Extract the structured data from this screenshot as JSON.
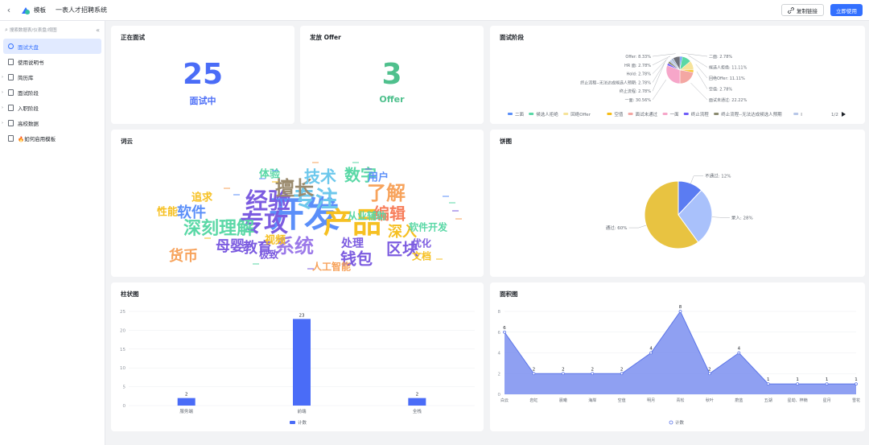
{
  "topbar": {
    "back_icon": "chevron-left-icon",
    "template_label": "模板",
    "app_title": "一表人才招聘系统",
    "copy_link": "复制链接",
    "use_now": "立即使用"
  },
  "sidebar": {
    "search_placeholder": "搜索数据表/仪表盘/视图",
    "items": [
      {
        "label": "面试大盘",
        "active": true,
        "expandable": false
      },
      {
        "label": "使用说明书",
        "active": false,
        "expandable": false
      },
      {
        "label": "简历库",
        "active": false,
        "expandable": true
      },
      {
        "label": "面试阶段",
        "active": false,
        "expandable": true
      },
      {
        "label": "入职阶段",
        "active": false,
        "expandable": true
      },
      {
        "label": "高校数据",
        "active": false,
        "expandable": true
      },
      {
        "label": "🔥如何启用模板",
        "active": false,
        "expandable": false
      }
    ]
  },
  "cards": {
    "interviewing": {
      "title": "正在面试",
      "value": "25",
      "label": "面试中",
      "color": "#4a6cf7"
    },
    "offer": {
      "title": "发放 Offer",
      "value": "3",
      "label": "Offer",
      "color": "#4fc08d"
    },
    "stage": {
      "title": "面试阶段"
    },
    "wordcloud": {
      "title": "词云"
    },
    "pie": {
      "title": "饼图"
    },
    "bar": {
      "title": "柱状图"
    },
    "area": {
      "title": "面积图"
    }
  },
  "chart_data": [
    {
      "type": "pie",
      "title": "面试阶段",
      "slices": [
        {
          "name": "二面",
          "value": 2.78,
          "label": "二面: 2.78%",
          "color": "#5b8ff9"
        },
        {
          "name": "候选人拒绝",
          "value": 11.11,
          "label": "候选人拒绝: 11.11%",
          "color": "#5ad8a6"
        },
        {
          "name": "回绝Offer",
          "value": 11.11,
          "label": "回绝Offer: 11.11%",
          "color": "#f6e39a"
        },
        {
          "name": "空值",
          "value": 2.78,
          "label": "空值: 2.78%",
          "color": "#f6bd16"
        },
        {
          "name": "面试未通过",
          "value": 22.22,
          "label": "面试未通过: 22.22%",
          "color": "#f4a7a3"
        },
        {
          "name": "一面",
          "value": 30.56,
          "label": "一面: 30.56%",
          "color": "#f6a6c9"
        },
        {
          "name": "终止流程",
          "value": 2.78,
          "label": "终止流程: 2.78%",
          "color": "#6f5ef9"
        },
        {
          "name": "终止流程--无法达成候选人预期",
          "value": 2.78,
          "label": "终止流程--无法达成候选人预期: 2.78%",
          "color": "#8a8a6f"
        },
        {
          "name": "Hold",
          "value": 2.78,
          "label": "Hold: 2.78%",
          "color": "#b8c7e8"
        },
        {
          "name": "HR 面",
          "value": 2.78,
          "label": "HR 面: 2.78%",
          "color": "#a9b8d0"
        },
        {
          "name": "Offer",
          "value": 8.33,
          "label": "Offer: 8.33%",
          "color": "#6e7079"
        }
      ],
      "legend": [
        "二面",
        "候选人拒绝",
        "回绝Offer",
        "空值",
        "面试未通过",
        "一面",
        "终止流程",
        "终止流程--无法达成候选人预期",
        "I"
      ],
      "legend_page": "1/2"
    },
    {
      "type": "pie",
      "title": "饼图",
      "slices": [
        {
          "name": "不通过",
          "value": 12,
          "label": "不通过: 12%",
          "color": "#5b7cf2"
        },
        {
          "name": "录入",
          "value": 28,
          "label": "录入: 28%",
          "color": "#a9c1fb"
        },
        {
          "name": "通过",
          "value": 60,
          "label": "通过: 60%",
          "color": "#e8c341"
        }
      ]
    },
    {
      "type": "bar",
      "title": "柱状图",
      "categories": [
        "服务端",
        "前端",
        "全栈"
      ],
      "values": [
        2,
        23,
        2
      ],
      "ylim": [
        0,
        25
      ],
      "yticks": [
        0,
        5,
        10,
        15,
        20,
        25
      ],
      "legend": "计数",
      "color": "#4a6cf7"
    },
    {
      "type": "area",
      "title": "面积图",
      "categories": [
        "白云",
        "岩虹",
        "晨曦",
        "海岸",
        "空值",
        "明月",
        "青松",
        "秋叶",
        "蔚蓝",
        "五湖",
        "星劫、梓楠",
        "星月",
        "雪花"
      ],
      "values": [
        6,
        2,
        2,
        2,
        2,
        4,
        8,
        2,
        4,
        1,
        1,
        1,
        1
      ],
      "ylim": [
        0,
        8
      ],
      "yticks": [
        0,
        2,
        4,
        6,
        8
      ],
      "legend": "计数",
      "color": "#7b8ff0"
    }
  ],
  "wordcloud_words": [
    {
      "text": "开发",
      "color": "#5b8ff9",
      "size": 44
    },
    {
      "text": "产品",
      "color": "#f6c022",
      "size": 36
    },
    {
      "text": "专攻",
      "color": "#7c5ce0",
      "size": 30
    },
    {
      "text": "经验",
      "color": "#7c5ce0",
      "size": 28
    },
    {
      "text": "专注",
      "color": "#6dc8ec",
      "size": 28
    },
    {
      "text": "擅长",
      "color": "#9a8a6d",
      "size": 24
    },
    {
      "text": "深刻理解",
      "color": "#5ad8a6",
      "size": 22
    },
    {
      "text": "系统",
      "color": "#9b79e9",
      "size": 24
    },
    {
      "text": "了解",
      "color": "#f7a35c",
      "size": 24
    },
    {
      "text": "技术",
      "color": "#6dc8ec",
      "size": 20
    },
    {
      "text": "数字",
      "color": "#5ad8a6",
      "size": 20
    },
    {
      "text": "编辑",
      "color": "#f77e5b",
      "size": 20
    },
    {
      "text": "区块",
      "color": "#7c5ce0",
      "size": 20
    },
    {
      "text": "钱包",
      "color": "#7c5ce0",
      "size": 20
    },
    {
      "text": "软件",
      "color": "#5b8ff9",
      "size": 18
    },
    {
      "text": "母婴",
      "color": "#7c5ce0",
      "size": 18
    },
    {
      "text": "教育",
      "color": "#7c5ce0",
      "size": 18
    },
    {
      "text": "深入",
      "color": "#f6c022",
      "size": 18
    },
    {
      "text": "货币",
      "color": "#f7a35c",
      "size": 18
    },
    {
      "text": "处理",
      "color": "#7c5ce0",
      "size": 14
    },
    {
      "text": "软件开发",
      "color": "#5ad8a6",
      "size": 12
    },
    {
      "text": "从业辅助",
      "color": "#5ad8a6",
      "size": 12
    },
    {
      "text": "人工智能",
      "color": "#f7a35c",
      "size": 12
    },
    {
      "text": "追求",
      "color": "#f6c022",
      "size": 13
    },
    {
      "text": "性能",
      "color": "#f6c022",
      "size": 13
    },
    {
      "text": "体验",
      "color": "#5ad8a6",
      "size": 13
    },
    {
      "text": "用户",
      "color": "#5b8ff9",
      "size": 13
    },
    {
      "text": "视频",
      "color": "#f6c022",
      "size": 13
    },
    {
      "text": "极致",
      "color": "#7c5ce0",
      "size": 12
    },
    {
      "text": "优化",
      "color": "#7c5ce0",
      "size": 12
    },
    {
      "text": "文档",
      "color": "#f6c022",
      "size": 12
    }
  ]
}
